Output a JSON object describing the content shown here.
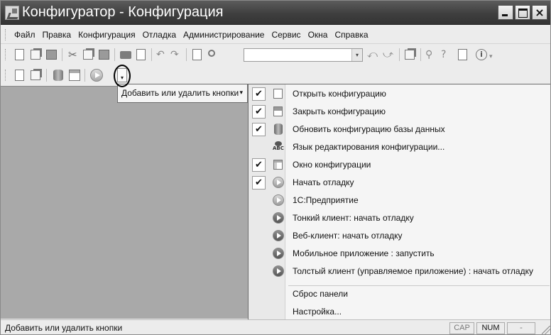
{
  "window": {
    "title": "Конфигуратор - Конфигурация",
    "close_glyph": "×"
  },
  "menubar": {
    "items": [
      "Файл",
      "Правка",
      "Конфигурация",
      "Отладка",
      "Администрирование",
      "Сервис",
      "Окна",
      "Справка"
    ]
  },
  "toolbar": {
    "search_value": "",
    "icons": [
      "new-document-icon",
      "open-icon",
      "save-icon",
      "cut-icon",
      "copy-icon",
      "paste-icon",
      "print-icon",
      "print-preview-icon",
      "undo-icon",
      "redo-icon",
      "find-icon",
      "search-icon",
      "find-next-icon",
      "find-previous-icon",
      "windows-icon",
      "syntax-assistant-icon",
      "help-icon",
      "info-icon"
    ],
    "dropdown_glyph": "▾"
  },
  "toolbar2": {
    "icons": [
      "open-configuration-icon",
      "close-configuration-icon",
      "update-database-icon",
      "configuration-window-icon",
      "start-debugging-icon"
    ],
    "dropdown_glyph": "▾"
  },
  "popup": {
    "label": "Добавить или удалить кнопки",
    "arrow": "▾"
  },
  "menu": {
    "items": [
      {
        "label": "Открыть конфигурацию",
        "checked": true,
        "icon": "open-configuration-icon"
      },
      {
        "label": "Закрыть конфигурацию",
        "checked": true,
        "icon": "close-configuration-icon"
      },
      {
        "label": "Обновить конфигурацию базы данных",
        "checked": true,
        "icon": "update-database-icon"
      },
      {
        "label": "Язык редактирования конфигурации...",
        "checked": false,
        "icon": "language-abc-icon"
      },
      {
        "label": "Окно конфигурации",
        "checked": true,
        "icon": "configuration-window-icon"
      },
      {
        "label": "Начать отладку",
        "checked": true,
        "icon": "start-debugging-icon"
      },
      {
        "label": "1С:Предприятие",
        "checked": false,
        "icon": "enterprise-icon"
      },
      {
        "label": "Тонкий клиент: начать отладку",
        "checked": false,
        "icon": "thin-client-icon"
      },
      {
        "label": "Веб-клиент: начать отладку",
        "checked": false,
        "icon": "web-client-icon"
      },
      {
        "label": "Мобильное приложение : запустить",
        "checked": false,
        "icon": "mobile-app-icon"
      },
      {
        "label": "Толстый клиент (управляемое приложение) : начать отладку",
        "checked": false,
        "icon": "thick-client-icon"
      }
    ],
    "reset": "Сброс панели",
    "customize": "Настройка...",
    "check_glyph": "✔"
  },
  "status": {
    "text": "Добавить или удалить кнопки",
    "cap": "CAP",
    "num": "NUM",
    "extra": "-"
  }
}
